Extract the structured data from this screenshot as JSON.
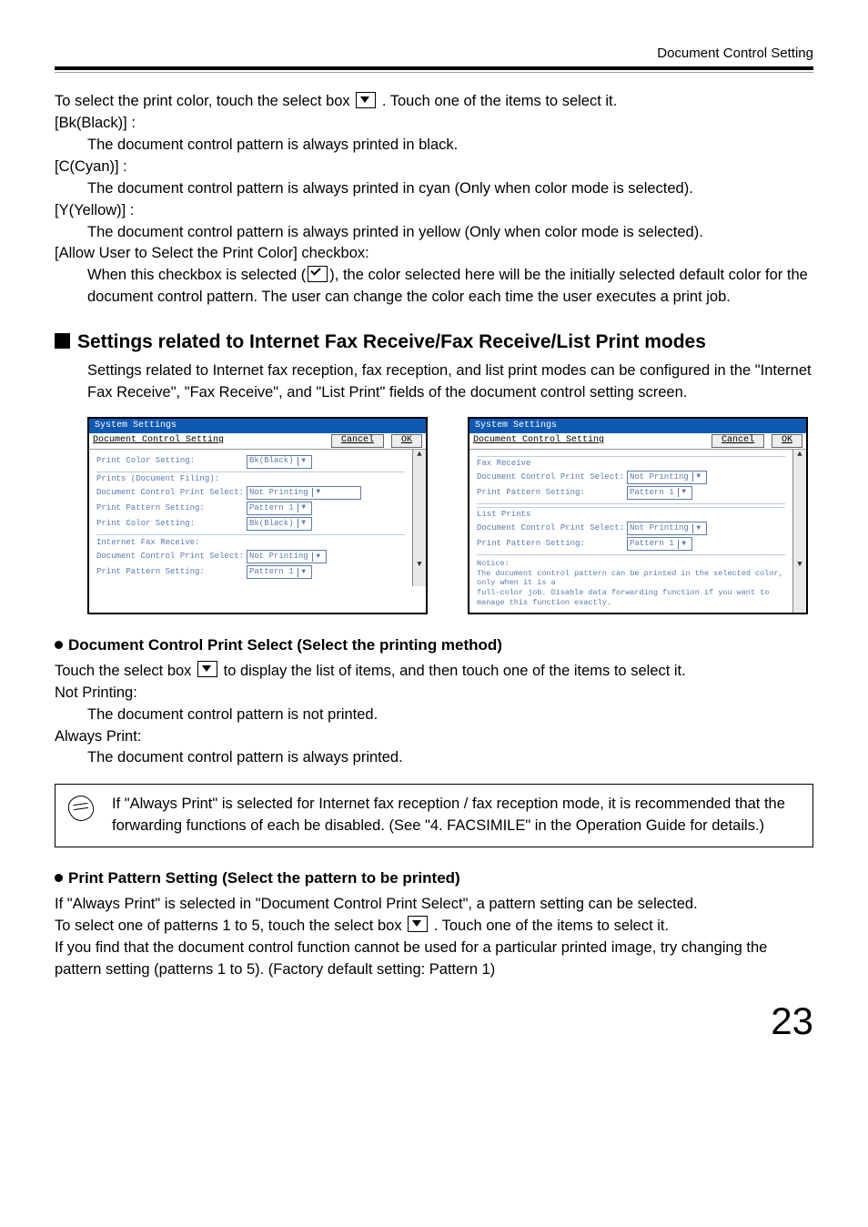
{
  "header": {
    "section": "Document Control Setting"
  },
  "intro": {
    "p1a": "To select the print color, touch the select box ",
    "p1b": " . Touch one of the items to select it.",
    "bk_label": "[Bk(Black)] :",
    "bk_desc": "The document control pattern is always printed in black.",
    "c_label": "[C(Cyan)] :",
    "c_desc": "The document control pattern is always printed in cyan (Only when color mode is selected).",
    "y_label": "[Y(Yellow)] :",
    "y_desc": "The document control pattern is always printed in yellow (Only when color mode is selected).",
    "allow_label": "[Allow User to Select the Print Color] checkbox:",
    "allow_desc_a": "When this checkbox is selected (",
    "allow_desc_b": "), the color selected here will be the initially selected default color for the document control pattern. The user can change the color each time the user executes a print job."
  },
  "section1": {
    "heading": "Settings related to Internet Fax Receive/Fax Receive/List Print modes",
    "para": "Settings related to Internet fax reception, fax reception, and list print modes can be configured in the \"Internet Fax Receive\", \"Fax Receive\", and \"List Print\" fields of the document control setting screen."
  },
  "panels": {
    "system_settings": "System Settings",
    "doc_control": "Document Control Setting",
    "cancel": "Cancel",
    "ok": "OK",
    "left": {
      "print_color_setting": "Print Color Setting:",
      "bk": "Bk(Black)",
      "prints_filing": "Prints (Document Filing):",
      "doc_ctrl_sel": "Document Control Print Select:",
      "not_printing": "Not Printing",
      "print_pattern": "Print Pattern Setting:",
      "pattern1": "Pattern 1",
      "ifax_receive": "Internet Fax Receive:"
    },
    "right": {
      "fax_receive": "Fax Receive",
      "list_prints": "List Prints",
      "notice_h": "Notice:",
      "notice1": "The document control pattern can be printed in the selected color, only when it is a",
      "notice2": "full-color job. Disable data forwarding function if you want to manage this function exactly."
    }
  },
  "sub1": {
    "heading": "Document Control Print Select (Select the printing method)",
    "p_a": "Touch the select box ",
    "p_b": " to display the list of items, and then touch one of the items to select it.",
    "np_label": "Not Printing:",
    "np_desc": "The document control pattern is not printed.",
    "ap_label": "Always Print:",
    "ap_desc": "The document control pattern is always printed."
  },
  "note": {
    "text": "If \"Always Print\" is selected for Internet fax reception / fax reception mode, it is recommended that the forwarding functions of each be disabled. (See \"4. FACSIMILE\" in the Operation Guide  for details.)"
  },
  "sub2": {
    "heading": "Print Pattern Setting (Select the pattern to be printed)",
    "p1": "If \"Always Print\" is selected in \"Document Control Print Select\", a pattern setting can be selected.",
    "p2a": "To select one of patterns 1 to 5, touch the select box ",
    "p2b": " . Touch one of the items to select it.",
    "p3": "If you find that the document control function cannot be used for a particular printed image, try changing the pattern setting (patterns 1 to 5). (Factory default setting: Pattern 1)"
  },
  "page_number": "23"
}
